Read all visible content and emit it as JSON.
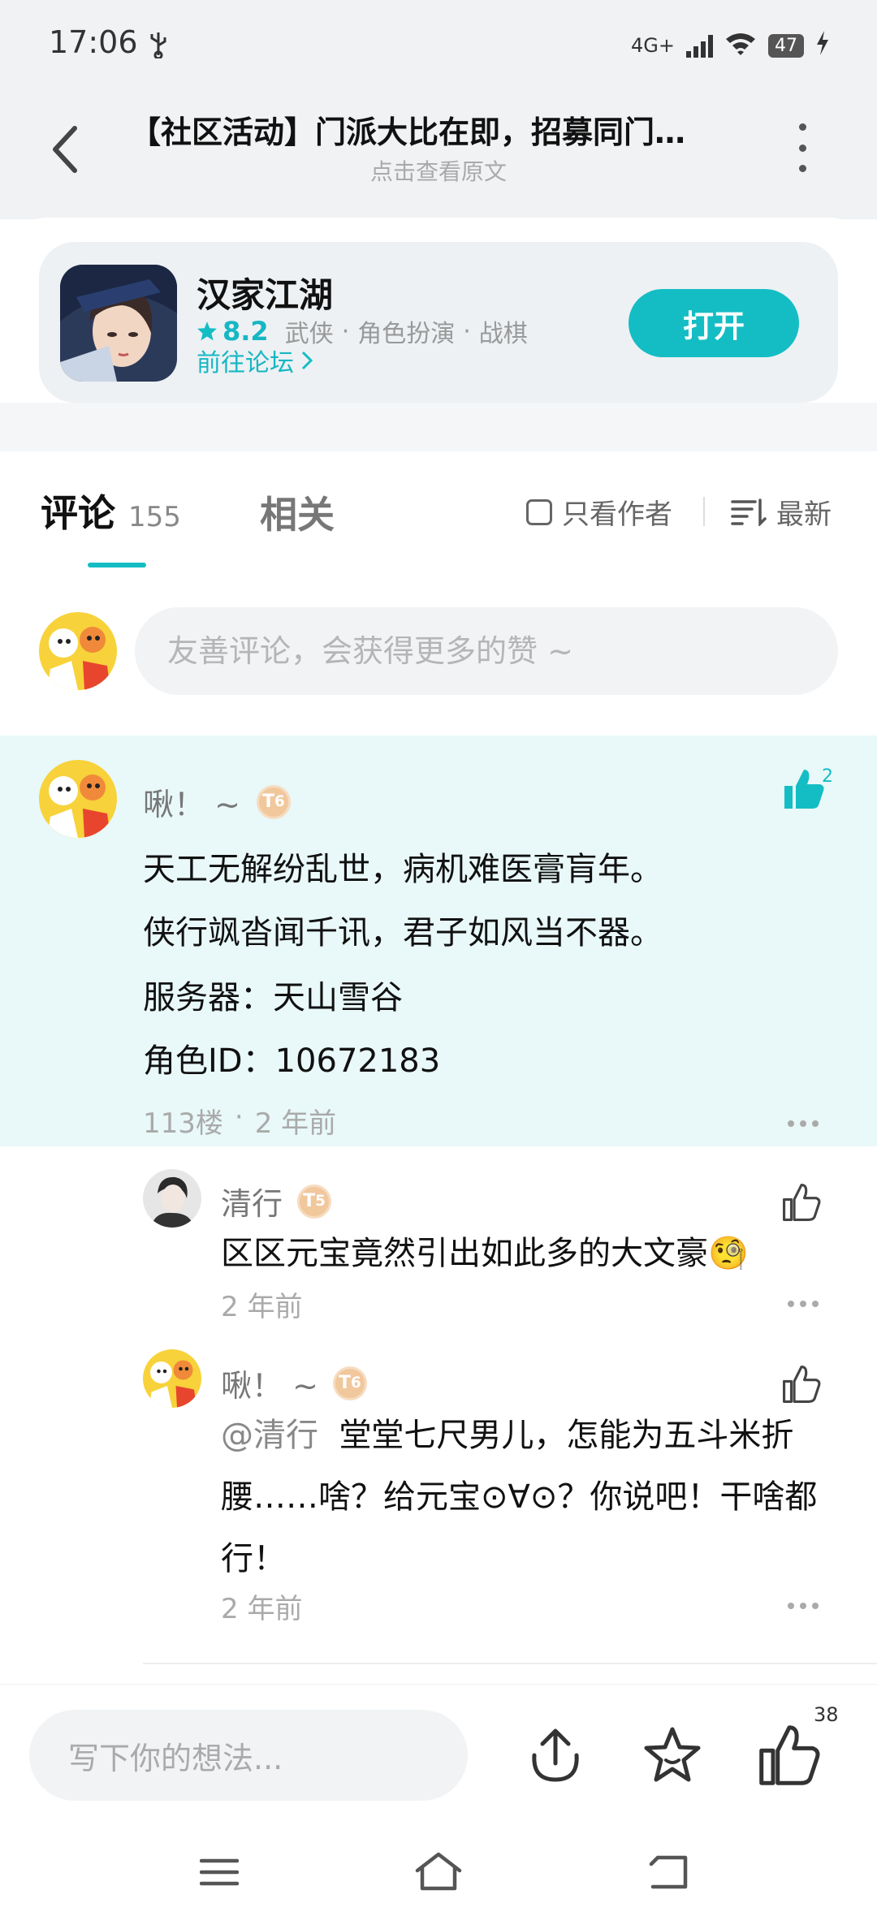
{
  "status": {
    "time": "17:06",
    "network": "4G+",
    "battery": "47"
  },
  "header": {
    "title": "【社区活动】门派大比在即，招募同门…",
    "subtitle": "点击查看原文"
  },
  "game": {
    "name": "汉家江湖",
    "rating": "8.2",
    "tags": [
      "武侠",
      "角色扮演",
      "战棋"
    ],
    "forum_link": "前往论坛",
    "open_label": "打开"
  },
  "tabs": {
    "comments_label": "评论",
    "comments_count": "155",
    "related_label": "相关",
    "author_only": "只看作者",
    "sort": "最新"
  },
  "comment_input": {
    "placeholder": "友善评论，会获得更多的赞 ~"
  },
  "main_comment": {
    "username": "啾！ ~",
    "level": "6",
    "likes": "2",
    "lines": [
      "天工无解纷乱世，病机难医膏肓年。",
      "侠行飒沓闻千讯，君子如风当不器。",
      "服务器：天山雪谷",
      "角色ID：10672183"
    ],
    "floor": "113楼",
    "time": "2 年前"
  },
  "replies": [
    {
      "username": "清行",
      "level": "5",
      "text": "区区元宝竟然引出如此多的大文豪🧐",
      "time": "2 年前"
    },
    {
      "username": "啾！ ~",
      "level": "6",
      "mention": "@清行",
      "text": "堂堂七尺男儿，怎能为五斗米折腰……啥？给元宝⊙∀⊙？你说吧！干啥都行！",
      "time": "2 年前"
    }
  ],
  "bottom_bar": {
    "placeholder": "写下你的想法...",
    "like_count": "38"
  },
  "colors": {
    "accent": "#14bdc4",
    "highlight_bg": "#e9f8f8"
  }
}
